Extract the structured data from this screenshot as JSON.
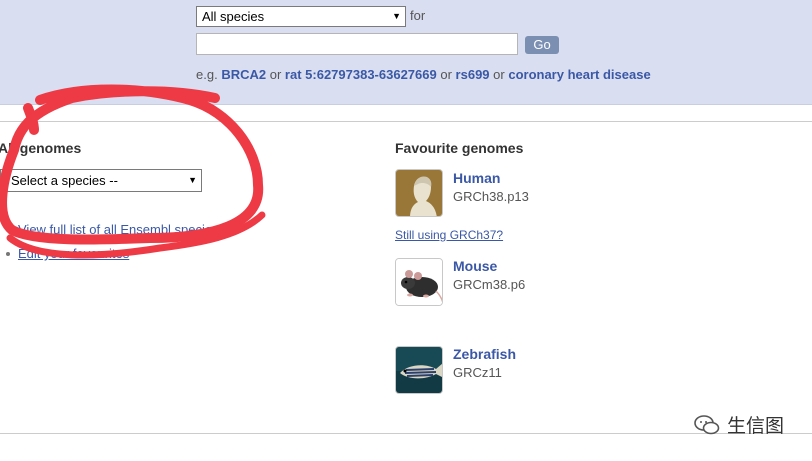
{
  "search": {
    "species_select_value": "All species",
    "for_label": "for",
    "query_placeholder": "",
    "go_label": "Go",
    "examples_prefix": "e.g.",
    "example_1": "BRCA2",
    "or_1": "or",
    "example_2": "rat 5:62797383-63627669",
    "or_2": "or",
    "example_3": "rs699",
    "or_3": "or",
    "example_4": "coronary heart disease"
  },
  "all_genomes": {
    "title": "All genomes",
    "select_value": "Select a species --",
    "links": [
      "View full list of all Ensembl species",
      "Edit your favourites"
    ]
  },
  "favourites": {
    "title": "Favourite genomes",
    "items": [
      {
        "name": "Human",
        "assembly": "GRCh38.p13",
        "icon": "human-bust-icon"
      },
      {
        "name": "Mouse",
        "assembly": "GRCm38.p6",
        "icon": "mouse-icon"
      },
      {
        "name": "Zebrafish",
        "assembly": "GRCz11",
        "icon": "zebrafish-icon"
      }
    ],
    "still_using_link": "Still using GRCh37?"
  },
  "watermark": {
    "text": "生信图",
    "icon": "wechat-logo-icon"
  },
  "colors": {
    "search_band": "#d9dff1",
    "link_blue": "#3b58a6",
    "go_button": "#7b8fb3",
    "annotation_red": "#ee3a45"
  }
}
